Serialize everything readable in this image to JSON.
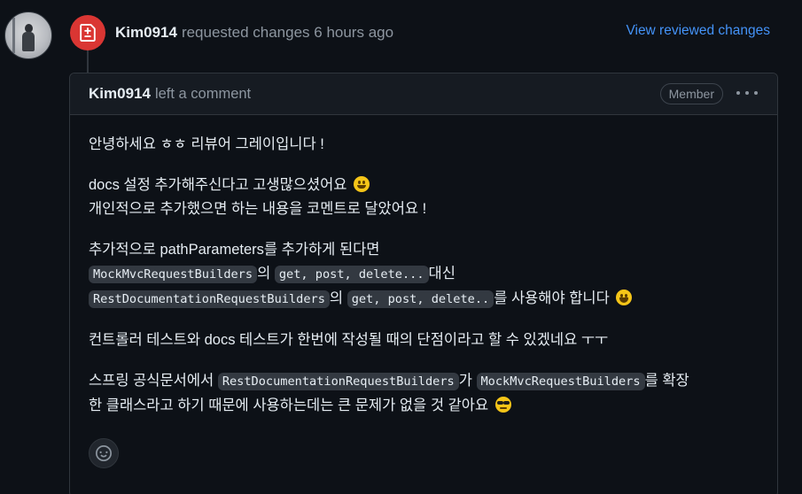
{
  "event": {
    "author": "Kim0914",
    "action_text": "requested changes 6 hours ago",
    "view_link": "View reviewed changes"
  },
  "comment": {
    "author": "Kim0914",
    "action_text": "left a comment",
    "role_badge": "Member",
    "paragraphs": {
      "p1": "안녕하세요 ㅎㅎ 리뷰어 그레이입니다 !",
      "p2_line1": "docs 설정 추가해주신다고 고생많으셨어요",
      "p2_line2": "개인적으로 추가했으면 하는 내용을 코멘트로 달았어요 !",
      "p3_line1": "추가적으로 pathParameters를 추가하게 된다면",
      "p3_code1": "MockMvcRequestBuilders",
      "p3_text1": "의",
      "p3_code2": "get, post, delete...",
      "p3_text2": "대신",
      "p3_code3": "RestDocumentationRequestBuilders",
      "p3_text3": "의",
      "p3_code4": "get, post, delete..",
      "p3_text4": "를 사용해야 합니다",
      "p4": "컨트롤러 테스트와 docs 테스트가 한번에 작성될 때의 단점이라고 할 수 있겠네요 ㅜㅜ",
      "p5_text1": "스프링 공식문서에서",
      "p5_code1": "RestDocumentationRequestBuilders",
      "p5_text2": "가",
      "p5_code2": "MockMvcRequestBuilders",
      "p5_text3": "를 확장",
      "p5_line2": "한 클래스라고 하기 때문에 사용하는데는 큰 문제가 없을 것 같아요"
    }
  },
  "colors": {
    "badge_red": "#da3633",
    "link_blue": "#4493f8",
    "background": "#0d1117"
  },
  "icons": {
    "review_badge": "file-diff-icon",
    "reaction": "smiley-icon",
    "menu": "kebab-horizontal-icon"
  }
}
